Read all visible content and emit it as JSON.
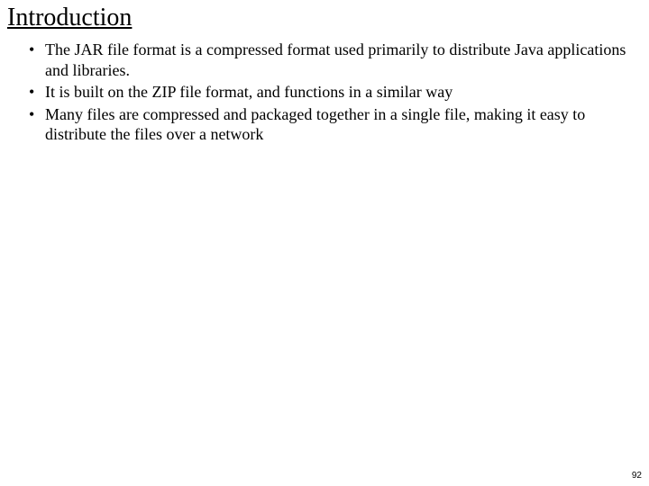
{
  "slide": {
    "title": "Introduction",
    "bullets": [
      "The JAR file format is a compressed format used primarily to distribute Java applications and libraries.",
      "It is built on the ZIP file format, and functions in a similar way",
      "Many files are compressed and packaged together in a single file, making it easy to distribute the files over a network"
    ],
    "page_number": "92"
  }
}
